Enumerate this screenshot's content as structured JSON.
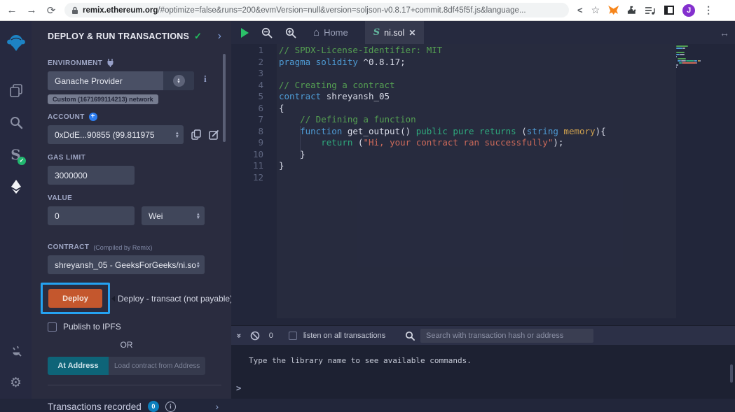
{
  "browser": {
    "back": "←",
    "forward": "→",
    "reload": "⟳",
    "url_host": "remix.ethereum.org",
    "url_path": "/#optimize=false&runs=200&evmVersion=null&version=soljson-v0.8.17+commit.8df45f5f.js&language...",
    "share": "<",
    "star": "☆",
    "dots": "⋮",
    "avatar_letter": "J"
  },
  "panel": {
    "title": "DEPLOY & RUN TRANSACTIONS",
    "title_check": "✓",
    "title_chevron": "›",
    "environment": {
      "label": "ENVIRONMENT",
      "value": "Ganache Provider",
      "network_badge": "Custom (1671699114213) network"
    },
    "account": {
      "label": "ACCOUNT",
      "plus": "+",
      "value": "0xDdE...90855 (99.811975"
    },
    "gas_limit": {
      "label": "GAS LIMIT",
      "value": "3000000"
    },
    "value": {
      "label": "VALUE",
      "value": "0",
      "unit": "Wei"
    },
    "contract": {
      "label": "CONTRACT",
      "label_suffix": "(Compiled by Remix)",
      "value": "shreyansh_05 - GeeksForGeeks/ni.so"
    },
    "deploy_button": "Deploy",
    "deploy_tooltip": "Deploy - transact (not payable)",
    "publish_label": "Publish to IPFS",
    "or_text": "OR",
    "at_address_button": "At Address",
    "at_address_placeholder": "Load contract from Address",
    "transactions": {
      "label": "Transactions recorded",
      "count": "0",
      "info": "i",
      "chevron": "›"
    }
  },
  "editor": {
    "tab_home": "Home",
    "tab_home_icon": "⌂",
    "tab_file": "ni.sol",
    "tab_file_icon": "S",
    "tab_close": "✕",
    "resize_icon": "↔",
    "code_lines": [
      {
        "n": "1",
        "t": [
          [
            "cm",
            "// SPDX-License-Identifier: MIT"
          ]
        ]
      },
      {
        "n": "2",
        "t": [
          [
            "kw",
            "pragma solidity "
          ],
          [
            "pl",
            "^0.8.17;"
          ]
        ]
      },
      {
        "n": "3",
        "t": []
      },
      {
        "n": "4",
        "t": [
          [
            "cm",
            "// Creating a contract"
          ]
        ]
      },
      {
        "n": "5",
        "t": [
          [
            "kw",
            "contract "
          ],
          [
            "pl",
            "shreyansh_05"
          ]
        ]
      },
      {
        "n": "6",
        "t": [
          [
            "pl",
            "{"
          ]
        ]
      },
      {
        "n": "7",
        "t": [
          [
            "pl",
            "    "
          ],
          [
            "cm",
            "// Defining a function"
          ]
        ]
      },
      {
        "n": "8",
        "t": [
          [
            "pl",
            "    "
          ],
          [
            "kw",
            "function "
          ],
          [
            "pl",
            "get_output() "
          ],
          [
            "gr",
            "public pure returns "
          ],
          [
            "pl",
            "("
          ],
          [
            "kw",
            "string"
          ],
          [
            "pl",
            " "
          ],
          [
            "or",
            "memory"
          ],
          [
            "pl",
            "){"
          ]
        ]
      },
      {
        "n": "9",
        "t": [
          [
            "pl",
            "        "
          ],
          [
            "gr",
            "return "
          ],
          [
            "pl",
            "("
          ],
          [
            "st",
            "\"Hi, your contract ran successfully\""
          ],
          [
            "pl",
            ");"
          ]
        ]
      },
      {
        "n": "10",
        "t": [
          [
            "pl",
            "    }"
          ]
        ]
      },
      {
        "n": "11",
        "t": [
          [
            "pl",
            "}"
          ]
        ]
      },
      {
        "n": "12",
        "t": []
      }
    ]
  },
  "terminal": {
    "collapse_icon": "»",
    "count": "0",
    "listen_label": "listen on all transactions",
    "search_placeholder": "Search with transaction hash or address",
    "message": "Type the library name to see available commands.",
    "prompt": ">"
  },
  "colors": {
    "accent_blue": "#25a2f1",
    "deploy_orange": "#c4572d",
    "at_address_teal": "#0e6478",
    "check_green": "#21c25e",
    "metamask_orange": "#f6851b"
  }
}
